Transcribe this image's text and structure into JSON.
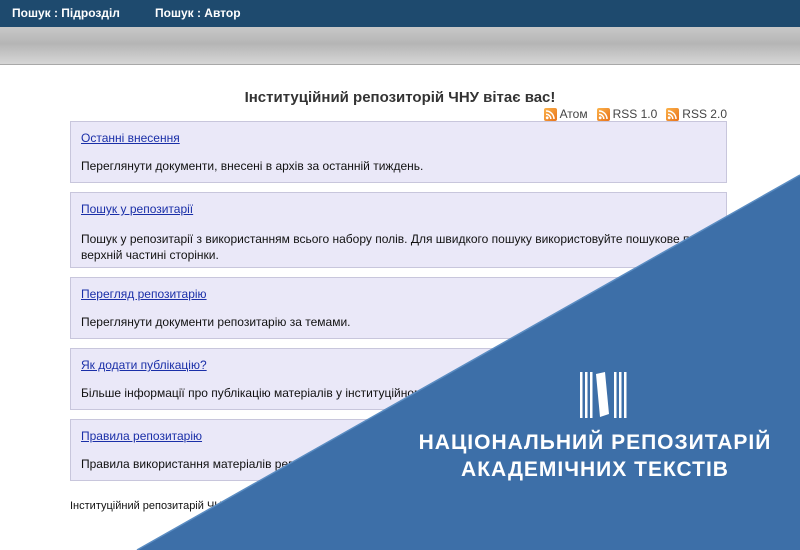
{
  "nav": {
    "search_by_unit": "Пошук : Підрозділ",
    "search_by_author": "Пошук : Автор"
  },
  "main": {
    "title": "Інституційний репозиторій ЧНУ вітає вас!",
    "feeds": [
      "Атом",
      "RSS 1.0",
      "RSS 2.0"
    ],
    "boxes": [
      {
        "link": "Останні внесення",
        "desc": "Переглянути документи, внесені в архів за останній тиждень."
      },
      {
        "link": "Пошук у репозитарії",
        "desc": "Пошук у репозитарії з використанням всього набору полів. Для швидкого пошуку використовуйте пошукове поле верхній частині сторінки."
      },
      {
        "link": "Перегляд репозитарію",
        "desc": "Переглянути документи репозитарію за темами."
      },
      {
        "link": "Як додати публікацію?",
        "desc": "Більше інформації про публікацію матеріалів у інституційному"
      },
      {
        "link": "Правила репозитарію",
        "desc": "Правила використання матеріалів репозитарію"
      }
    ],
    "footer": "Інституційний репозитарій ЧНУ"
  },
  "banner": {
    "line1": "НАЦІОНАЛЬНИЙ РЕПОЗИТАРІЙ",
    "line2": "АКАДЕМІЧНИХ ТЕКСТІВ",
    "logo_icon": "book-library-icon"
  },
  "colors": {
    "nav_bg": "#1e4a6e",
    "box_bg": "#eae8f8",
    "link": "#1a2fa8",
    "banner": "#3d6fa8",
    "rss": "#f08a24"
  }
}
